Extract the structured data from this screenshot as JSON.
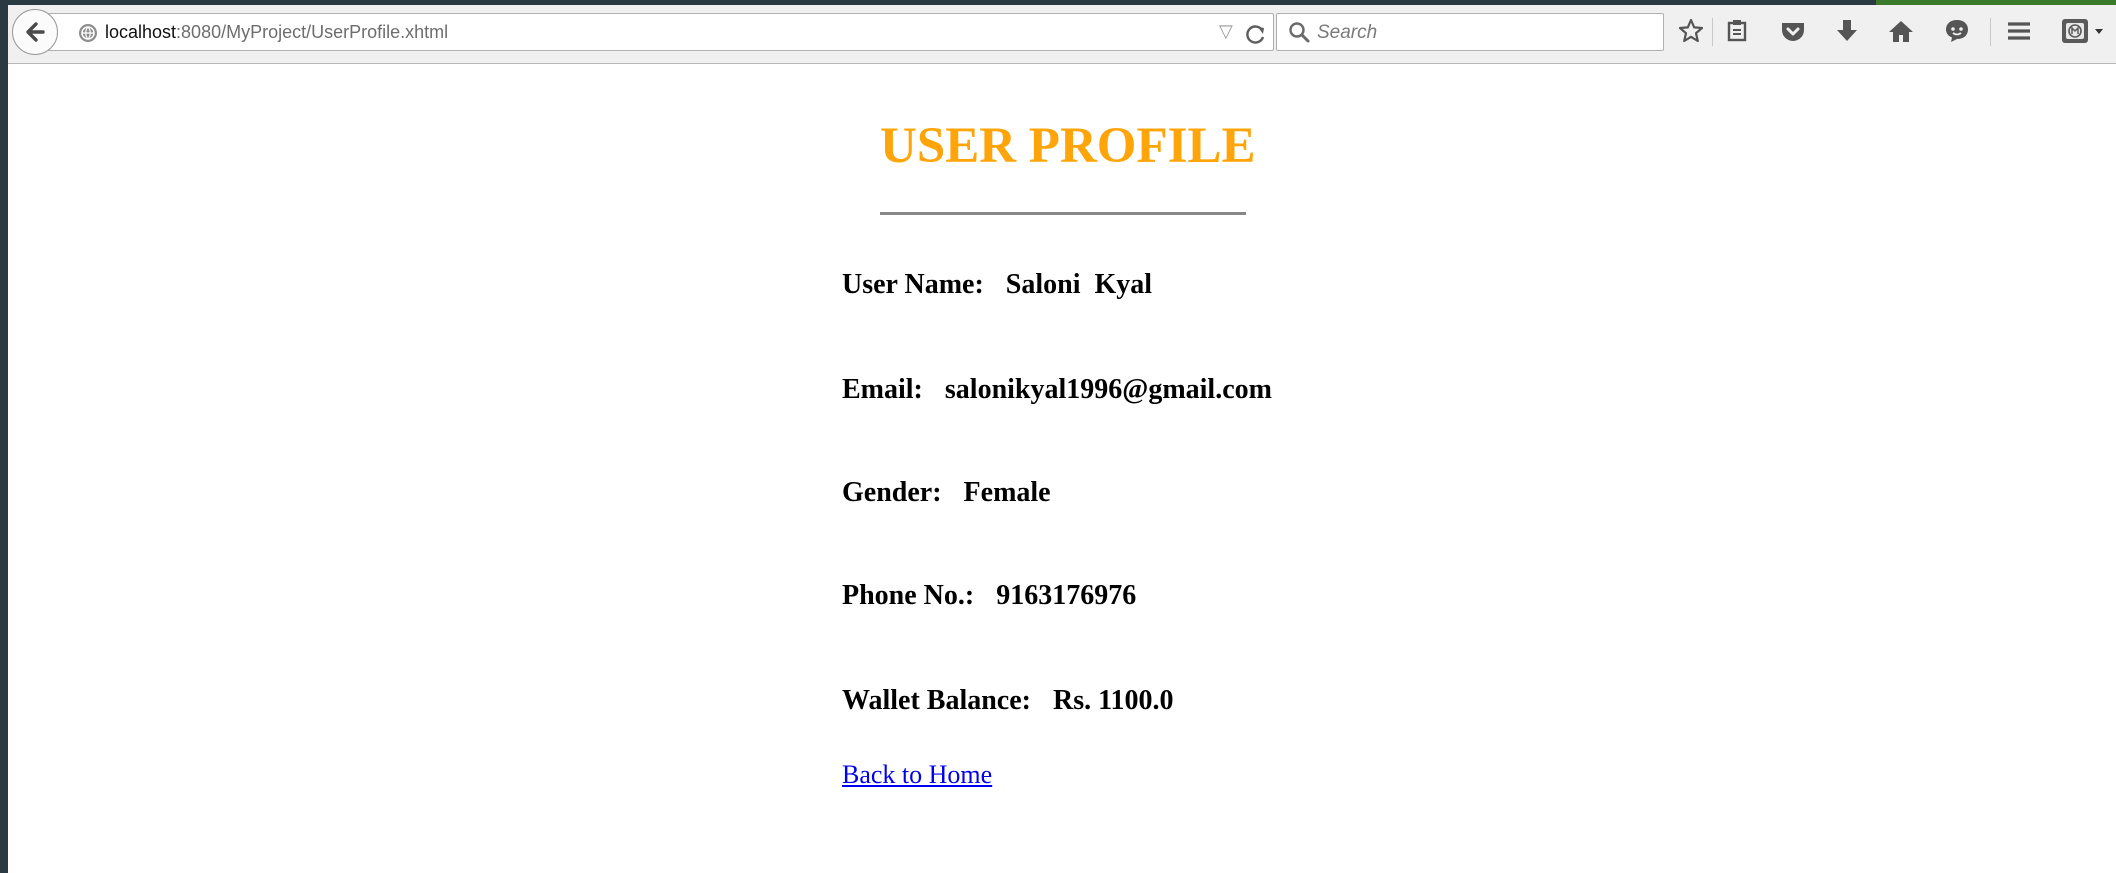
{
  "browser": {
    "url_host": "localhost",
    "url_path": ":8080/MyProject/UserProfile.xhtml",
    "search_placeholder": "Search",
    "accent_green": "#3b7a2a",
    "toolbar_icons": [
      "back-icon",
      "site-info-icon",
      "url-dropdown-icon",
      "reload-icon",
      "search-icon",
      "bookmark-star-icon",
      "reading-list-icon",
      "pocket-icon",
      "download-icon",
      "home-icon",
      "chat-icon",
      "menu-icon",
      "extension-icon"
    ]
  },
  "page": {
    "title": "USER PROFILE",
    "title_color": "#ffa50a",
    "fields": [
      {
        "label": "User Name:",
        "value": "Saloni  Kyal"
      },
      {
        "label": "Email:",
        "value": "salonikyal1996@gmail.com"
      },
      {
        "label": "Gender:",
        "value": "Female"
      },
      {
        "label": "Phone No.:",
        "value": "9163176976"
      },
      {
        "label": "Wallet Balance:",
        "value": "Rs. 1100.0"
      }
    ],
    "back_link": "Back to Home",
    "link_color": "#0000ee"
  }
}
